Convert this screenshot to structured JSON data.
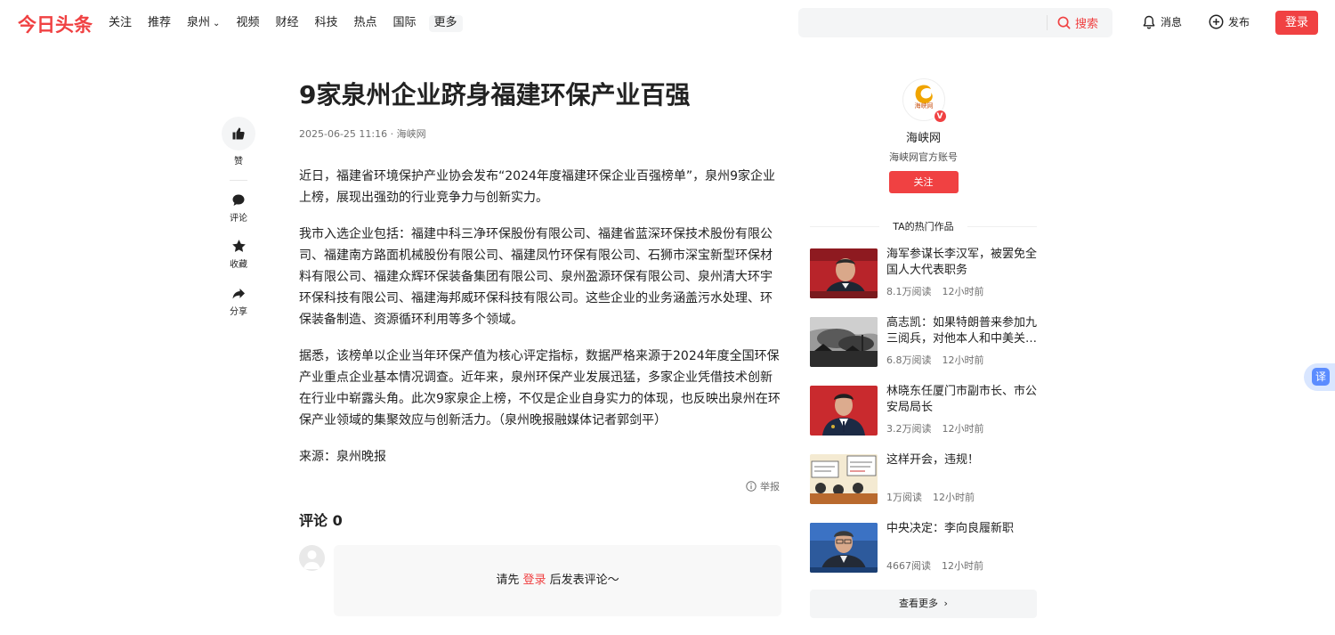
{
  "header": {
    "logo": "今日头条",
    "nav": [
      "关注",
      "推荐",
      "泉州",
      "视频",
      "财经",
      "科技",
      "热点",
      "国际"
    ],
    "nav_more": "更多",
    "search_placeholder": "",
    "search_button": "搜索",
    "messages": "消息",
    "publish": "发布",
    "login": "登录"
  },
  "actions": {
    "like": "赞",
    "comment": "评论",
    "favorite": "收藏",
    "share": "分享"
  },
  "article": {
    "title": "9家泉州企业跻身福建环保产业百强",
    "meta": "2025-06-25 11:16 · 海峡网",
    "paragraphs": [
      "近日，福建省环境保护产业协会发布“2024年度福建环保企业百强榜单”，泉州9家企业上榜，展现出强劲的行业竞争力与创新实力。",
      "我市入选企业包括：福建中科三净环保股份有限公司、福建省蓝深环保技术股份有限公司、福建南方路面机械股份有限公司、福建凤竹环保有限公司、石狮市深宝新型环保材料有限公司、福建众辉环保装备集团有限公司、泉州盈源环保有限公司、泉州清大环宇环保科技有限公司、福建海邦威环保科技有限公司。这些企业的业务涵盖污水处理、环保装备制造、资源循环利用等多个领域。",
      "据悉，该榜单以企业当年环保产值为核心评定指标，数据严格来源于2024年度全国环保产业重点企业基本情况调查。近年来，泉州环保产业发展迅猛，多家企业凭借技术创新在行业中崭露头角。此次9家泉企上榜，不仅是企业自身实力的体现，也反映出泉州在环保产业领域的集聚效应与创新活力。（泉州晚报融媒体记者郭剑平）",
      "来源：泉州晚报"
    ],
    "report": "举报"
  },
  "comments": {
    "title": "评论 0",
    "prompt_before": "请先 ",
    "prompt_link": "登录",
    "prompt_after": " 后发表评论～"
  },
  "author": {
    "name": "海峡网",
    "desc": "海峡网官方账号",
    "follow": "关注",
    "logo_text": "海峡网",
    "verified": "V"
  },
  "hot": {
    "title": "TA的热门作品",
    "items": [
      {
        "title": "海军参谋长李汉军，被罢免全国人大代表职务",
        "reads": "8.1万阅读",
        "time": "12小时前"
      },
      {
        "title": "高志凯：如果特朗普来参加九三阅兵，对他本人和中美关…",
        "reads": "6.8万阅读",
        "time": "12小时前"
      },
      {
        "title": "林晓东任厦门市副市长、市公安局局长",
        "reads": "3.2万阅读",
        "time": "12小时前"
      },
      {
        "title": "这样开会，违规！",
        "reads": "1万阅读",
        "time": "12小时前"
      },
      {
        "title": "中央决定：李向良履新职",
        "reads": "4667阅读",
        "time": "12小时前"
      }
    ],
    "see_more": "查看更多"
  },
  "translate": "译",
  "colors": {
    "brand": "#f04142"
  }
}
